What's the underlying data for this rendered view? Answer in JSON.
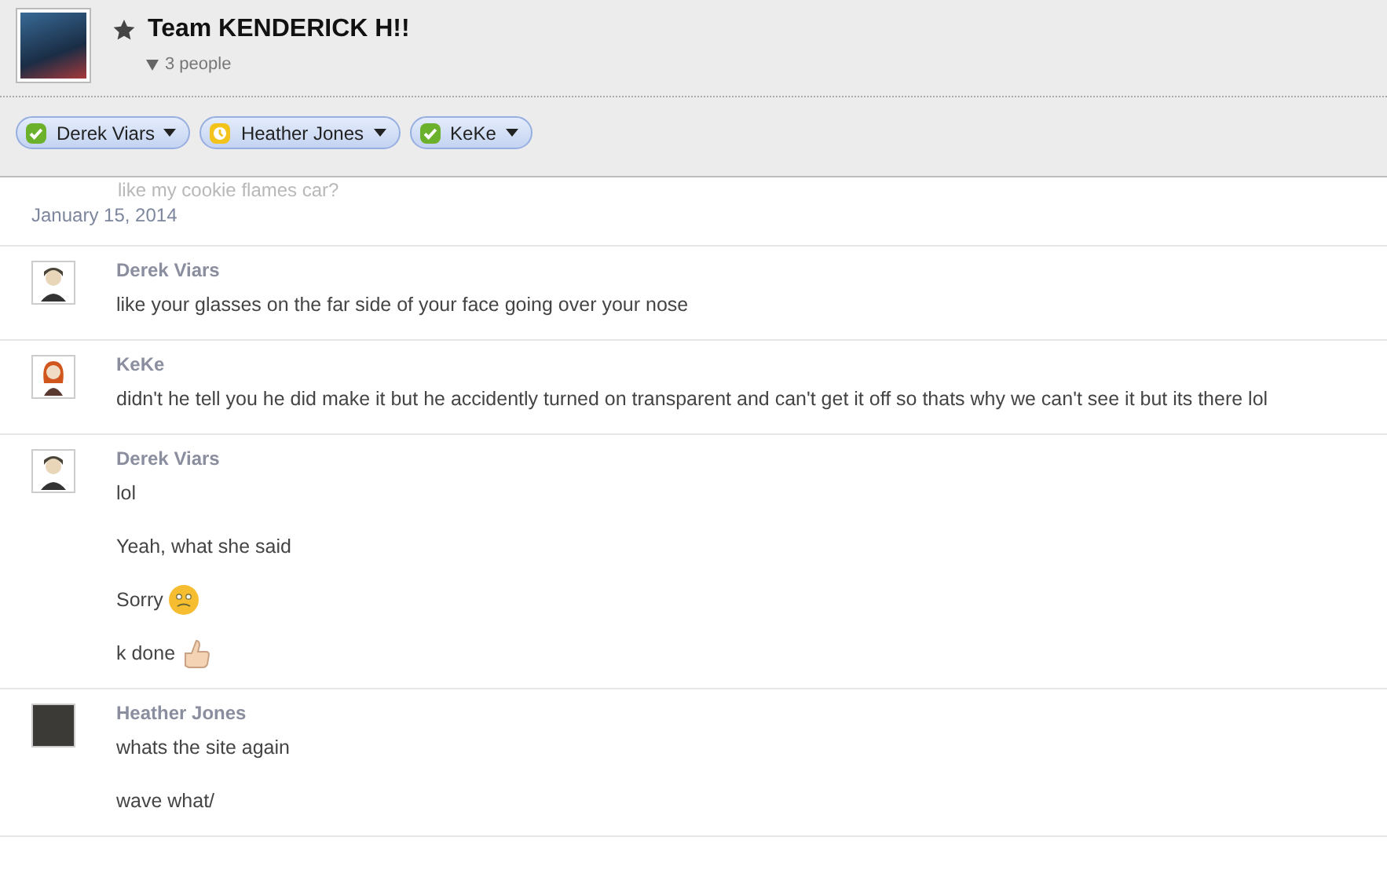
{
  "chat": {
    "title": "Team KENDERICK H!!",
    "starred": true,
    "people_count": "3 people",
    "participants": [
      {
        "name": "Derek Viars",
        "status": {
          "kind": "online"
        }
      },
      {
        "name": "Heather Jones",
        "status": {
          "kind": "away"
        }
      },
      {
        "name": "KeKe",
        "status": {
          "kind": "online"
        }
      }
    ]
  },
  "scrolled_text": "like my cookie flames car?",
  "date": "January 15, 2014",
  "messages": [
    {
      "author": "Derek Viars",
      "avatar": {
        "kind": "cartoon-boy"
      },
      "lines": [
        {
          "text": "like your glasses on the far side of your face going over your nose"
        }
      ]
    },
    {
      "author": "KeKe",
      "avatar": {
        "kind": "cartoon-girl"
      },
      "lines": [
        {
          "text": "didn't he tell you he did make it but he accidently turned on transparent and can't get it off so thats why we can't see it but its there lol"
        }
      ]
    },
    {
      "author": "Derek Viars",
      "avatar": {
        "kind": "cartoon-boy"
      },
      "lines": [
        {
          "text": "lol"
        },
        {
          "text": "Yeah, what she said"
        },
        {
          "text": "Sorry",
          "emoji": {
            "kind": "worried"
          }
        },
        {
          "text": "k done",
          "emoji": {
            "kind": "thumbs-up"
          }
        }
      ]
    },
    {
      "author": "Heather Jones",
      "avatar": {
        "kind": "photo"
      },
      "lines": [
        {
          "text": "whats the site again"
        },
        {
          "text": "wave what/"
        }
      ]
    }
  ]
}
